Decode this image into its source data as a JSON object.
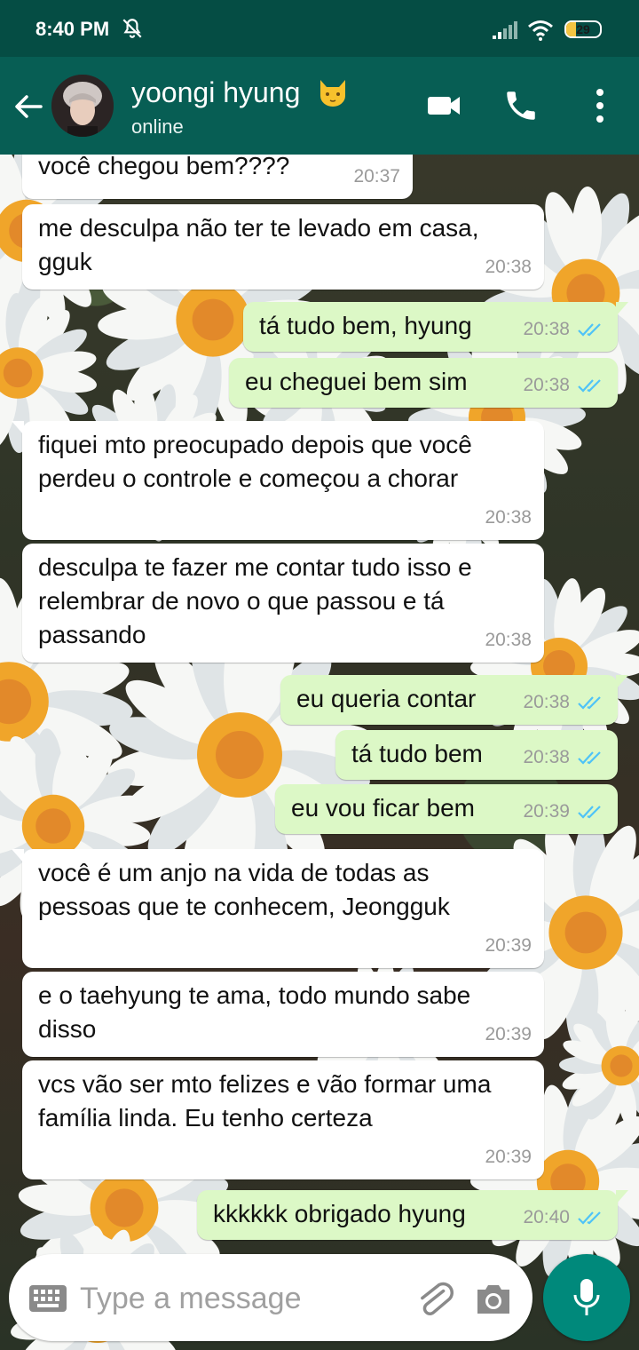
{
  "status_bar": {
    "time": "8:40 PM",
    "battery_level": "29",
    "icons": [
      "mute-icon",
      "signal-icon",
      "wifi-icon",
      "battery-icon"
    ]
  },
  "header": {
    "contact_name": "yoongi hyung",
    "contact_emoji": "cat-face-icon",
    "status": "online",
    "actions": [
      "back-arrow-icon",
      "video-call-icon",
      "phone-icon",
      "more-vertical-icon"
    ]
  },
  "messages": [
    {
      "direction": "in",
      "text": "você chegou bem????",
      "time": "20:37"
    },
    {
      "direction": "in",
      "text": "me desculpa não ter te levado em casa, gguk",
      "time": "20:38"
    },
    {
      "direction": "out",
      "text": "tá tudo bem, hyung",
      "time": "20:38",
      "read": true
    },
    {
      "direction": "out",
      "text": "eu cheguei bem sim",
      "time": "20:38",
      "read": true
    },
    {
      "direction": "in",
      "text": "fiquei mto preocupado depois que você perdeu o controle e começou a chorar",
      "time": "20:38"
    },
    {
      "direction": "in",
      "text": "desculpa te fazer me contar tudo isso e relembrar de novo o que passou e tá passando",
      "time": "20:38"
    },
    {
      "direction": "out",
      "text": "eu queria contar",
      "time": "20:38",
      "read": true
    },
    {
      "direction": "out",
      "text": "tá tudo bem",
      "time": "20:38",
      "read": true
    },
    {
      "direction": "out",
      "text": "eu vou ficar bem",
      "time": "20:39",
      "read": true
    },
    {
      "direction": "in",
      "text": "você é um anjo na vida de todas as pessoas que te conhecem, Jeongguk",
      "time": "20:39"
    },
    {
      "direction": "in",
      "text": "e o taehyung te ama, todo mundo sabe disso",
      "time": "20:39"
    },
    {
      "direction": "in",
      "text": "vcs vão ser mto felizes e vão formar uma família linda. Eu tenho certeza",
      "time": "20:39"
    },
    {
      "direction": "out",
      "text": "kkkkkk obrigado hyung",
      "time": "20:40",
      "read": true
    }
  ],
  "input": {
    "placeholder": "Type a message",
    "value": ""
  },
  "colors": {
    "header": "#075e54",
    "status_bar": "#054d44",
    "outgoing_bubble": "#dcf8c6",
    "incoming_bubble": "#ffffff",
    "read_ticks": "#4fc3f7",
    "mic_button": "#00897b"
  }
}
